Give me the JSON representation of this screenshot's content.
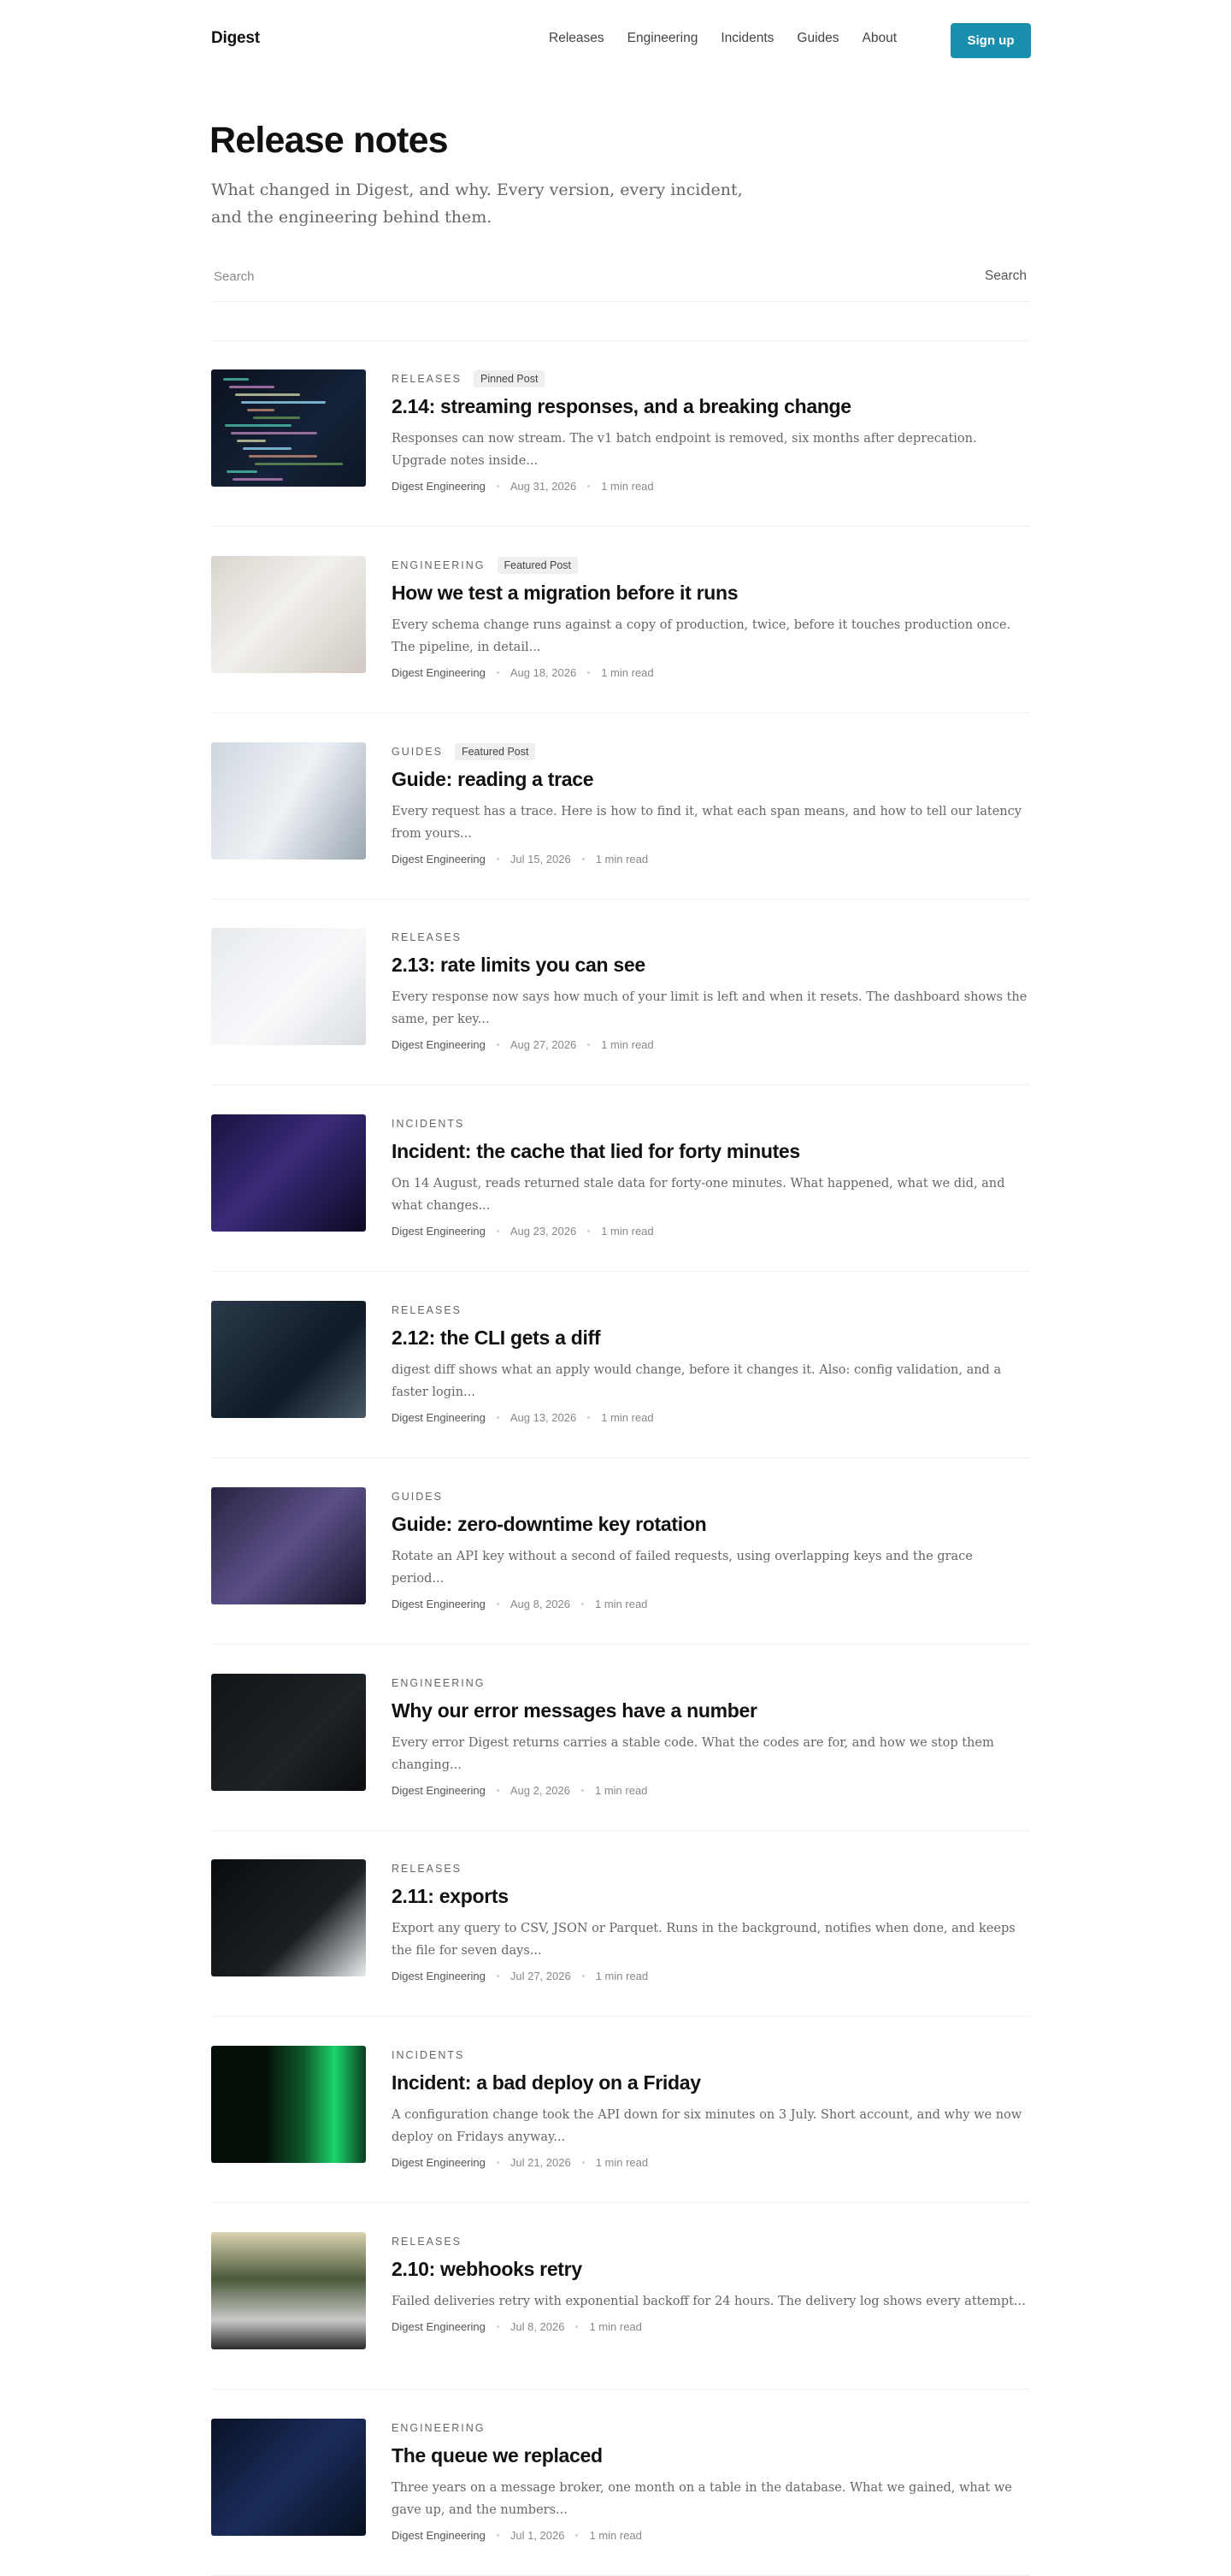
{
  "header": {
    "brand": "Digest",
    "nav": [
      "Releases",
      "Engineering",
      "Incidents",
      "Guides",
      "About"
    ],
    "signup_label": "Sign up"
  },
  "hero": {
    "title": "Release notes",
    "subtitle": "What changed in Digest, and why. Every version, every incident, and the engineering behind them."
  },
  "search": {
    "placeholder": "Search",
    "button_label": "Search"
  },
  "posts": [
    {
      "category": "Releases",
      "badge": "Pinned Post",
      "title": "2.14: streaming responses, and a breaking change",
      "excerpt": "Responses can now stream. The v1 batch endpoint is removed, six months after deprecation. Upgrade notes inside...",
      "author": "Digest Engineering",
      "date": "Aug 31, 2026",
      "read": "1 min read",
      "image": "code-screen"
    },
    {
      "category": "Engineering",
      "badge": "Featured Post",
      "title": "How we test a migration before it runs",
      "excerpt": "Every schema change runs against a copy of production, twice, before it touches production once. The pipeline, in detail...",
      "author": "Digest Engineering",
      "date": "Aug 18, 2026",
      "read": "1 min read",
      "image": "whiteboard-meeting"
    },
    {
      "category": "Guides",
      "badge": "Featured Post",
      "title": "Guide: reading a trace",
      "excerpt": "Every request has a trace. Here is how to find it, what each span means, and how to tell our latency from yours...",
      "author": "Digest Engineering",
      "date": "Jul 15, 2026",
      "read": "1 min read",
      "image": "dashboard-screen"
    },
    {
      "category": "Releases",
      "badge": "",
      "title": "2.13: rate limits you can see",
      "excerpt": "Every response now says how much of your limit is left and when it resets. The dashboard shows the same, per key...",
      "author": "Digest Engineering",
      "date": "Aug 27, 2026",
      "read": "1 min read",
      "image": "bar-chart"
    },
    {
      "category": "Incidents",
      "badge": "",
      "title": "Incident: the cache that lied for forty minutes",
      "excerpt": "On 14 August, reads returned stale data for forty-one minutes. What happened, what we did, and what changes...",
      "author": "Digest Engineering",
      "date": "Aug 23, 2026",
      "read": "1 min read",
      "image": "network-switch"
    },
    {
      "category": "Releases",
      "badge": "",
      "title": "2.12: the CLI gets a diff",
      "excerpt": "digest diff shows what an apply would change, before it changes it. Also: config validation, and a faster login...",
      "author": "Digest Engineering",
      "date": "Aug 13, 2026",
      "read": "1 min read",
      "image": "laptop-code"
    },
    {
      "category": "Guides",
      "badge": "",
      "title": "Guide: zero-downtime key rotation",
      "excerpt": "Rotate an API key without a second of failed requests, using overlapping keys and the grace period...",
      "author": "Digest Engineering",
      "date": "Aug 8, 2026",
      "read": "1 min read",
      "image": "keyboard"
    },
    {
      "category": "Engineering",
      "badge": "",
      "title": "Why our error messages have a number",
      "excerpt": "Every error Digest returns carries a stable code. What the codes are for, and how we stop them changing...",
      "author": "Digest Engineering",
      "date": "Aug 2, 2026",
      "read": "1 min read",
      "image": "terminal"
    },
    {
      "category": "Releases",
      "badge": "",
      "title": "2.11: exports",
      "excerpt": "Export any query to CSV, JSON or Parquet. Runs in the background, notifies when done, and keeps the file for seven days...",
      "author": "Digest Engineering",
      "date": "Jul 27, 2026",
      "read": "1 min read",
      "image": "monitor-charts"
    },
    {
      "category": "Incidents",
      "badge": "",
      "title": "Incident: a bad deploy on a Friday",
      "excerpt": "A configuration change took the API down for six minutes on 3 July. Short account, and why we now deploy on Fridays anyway...",
      "author": "Digest Engineering",
      "date": "Jul 21, 2026",
      "read": "1 min read",
      "image": "server-lights"
    },
    {
      "category": "Releases",
      "badge": "",
      "title": "2.10: webhooks retry",
      "excerpt": "Failed deliveries retry with exponential backoff for 24 hours. The delivery log shows every attempt...",
      "author": "Digest Engineering",
      "date": "Jul 8, 2026",
      "read": "1 min read",
      "image": "server-rack"
    },
    {
      "category": "Engineering",
      "badge": "",
      "title": "The queue we replaced",
      "excerpt": "Three years on a message broker, one month on a table in the database. What we gained, what we gave up, and the numbers...",
      "author": "Digest Engineering",
      "date": "Jul 1, 2026",
      "read": "1 min read",
      "image": "cables"
    }
  ]
}
